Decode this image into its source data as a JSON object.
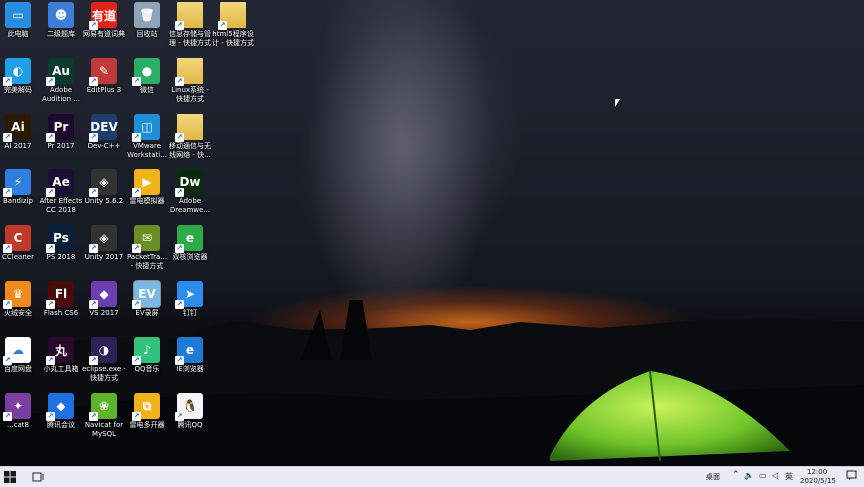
{
  "desktop": {
    "icons": [
      {
        "id": "pc",
        "label": "此电脑",
        "glyph": "▭",
        "bg": "#2a8ee0"
      },
      {
        "id": "erji",
        "label": "二级题库",
        "glyph": "☻",
        "bg": "#3b7fd8"
      },
      {
        "id": "youdao",
        "label": "网易有道词典",
        "glyph": "有道",
        "bg": "#e2231a"
      },
      {
        "id": "recycle",
        "label": "回收站",
        "glyph": "🗑",
        "bg": "#8fa3b8"
      },
      {
        "id": "info",
        "label": "信息存储与管\n理 - 快捷方式",
        "glyph": "",
        "bg": "#e8c15a"
      },
      {
        "id": "html5",
        "label": "html5程序设\n计 - 快捷方式",
        "glyph": "",
        "bg": "#e8c15a"
      },
      {
        "id": "wanmei",
        "label": "完美解码",
        "glyph": "◐",
        "bg": "#1e9fe6"
      },
      {
        "id": "audition",
        "label": "Adobe\nAudition ...",
        "glyph": "Au",
        "bg": "#0b3a2f"
      },
      {
        "id": "editplus",
        "label": "EditPlus 3",
        "glyph": "✎",
        "bg": "#c03a3a"
      },
      {
        "id": "wechat",
        "label": "微信",
        "glyph": "●",
        "bg": "#2aae67"
      },
      {
        "id": "linux",
        "label": "Linux系统 -\n快捷方式",
        "glyph": "",
        "bg": "#e8c15a"
      },
      {
        "id": "ai",
        "label": "AI 2017",
        "glyph": "Ai",
        "bg": "#2b1a00"
      },
      {
        "id": "pr",
        "label": "Pr 2017",
        "glyph": "Pr",
        "bg": "#1c0a2e"
      },
      {
        "id": "devcpp",
        "label": "Dev-C++",
        "glyph": "DEV",
        "bg": "#1d3d6b"
      },
      {
        "id": "vmware",
        "label": "VMware\nWorkstati...",
        "glyph": "◫",
        "bg": "#1c8fd6"
      },
      {
        "id": "mobile",
        "label": "移动通信与无\n线网络 - 快...",
        "glyph": "",
        "bg": "#e8c15a"
      },
      {
        "id": "bandizip",
        "label": "Bandizip",
        "glyph": "⚡",
        "bg": "#2f7fe0"
      },
      {
        "id": "ae",
        "label": "After Effects\nCC 2018",
        "glyph": "Ae",
        "bg": "#1b1033"
      },
      {
        "id": "unity562",
        "label": "Unity 5.6.2",
        "glyph": "◈",
        "bg": "#333"
      },
      {
        "id": "leidian",
        "label": "雷电模拟器",
        "glyph": "▶",
        "bg": "#f2b21a"
      },
      {
        "id": "dw",
        "label": "Adobe\nDreamwe...",
        "glyph": "Dw",
        "bg": "#082b0a"
      },
      {
        "id": "ccleaner",
        "label": "CCleaner",
        "glyph": "C",
        "bg": "#c0392b"
      },
      {
        "id": "ps",
        "label": "PS 2018",
        "glyph": "Ps",
        "bg": "#06203a"
      },
      {
        "id": "unity2017",
        "label": "Unity 2017",
        "glyph": "◈",
        "bg": "#333"
      },
      {
        "id": "packet",
        "label": "PacketTra...\n- 快捷方式",
        "glyph": "✉",
        "bg": "#6b8e23"
      },
      {
        "id": "shuanghe",
        "label": "双核浏览器",
        "glyph": "e",
        "bg": "#2eaa4a"
      },
      {
        "id": "huorong",
        "label": "火绒安全",
        "glyph": "♛",
        "bg": "#f08a1c"
      },
      {
        "id": "flash",
        "label": "Flash CS6",
        "glyph": "Fl",
        "bg": "#4a0a0a"
      },
      {
        "id": "vs",
        "label": "VS 2017",
        "glyph": "◆",
        "bg": "#6c3fb0"
      },
      {
        "id": "ev",
        "label": "EV录屏",
        "glyph": "EV",
        "bg": "#7ab8e6"
      },
      {
        "id": "dingding",
        "label": "钉钉",
        "glyph": "➤",
        "bg": "#2d8cf0"
      },
      {
        "id": "baidu",
        "label": "百度网盘",
        "glyph": "☁",
        "bg": "#fff"
      },
      {
        "id": "xiaowan",
        "label": "小丸工具箱",
        "glyph": "丸",
        "bg": "#2a0a2a"
      },
      {
        "id": "eclipse",
        "label": "eclipse.exe -\n快捷方式",
        "glyph": "◑",
        "bg": "#2c2255"
      },
      {
        "id": "qqmusic",
        "label": "QQ音乐",
        "glyph": "♪",
        "bg": "#31c27c"
      },
      {
        "id": "ie",
        "label": "IE浏览器",
        "glyph": "e",
        "bg": "#1f7ad6"
      },
      {
        "id": "navicat8",
        "label": "...cat8",
        "glyph": "✦",
        "bg": "#7b3fa0"
      },
      {
        "id": "tencentmeet",
        "label": "腾讯会议",
        "glyph": "⬥",
        "bg": "#1e6fe0"
      },
      {
        "id": "navicat",
        "label": "Navicat for\nMySQL",
        "glyph": "❀",
        "bg": "#5fb32a"
      },
      {
        "id": "leidianmulti",
        "label": "雷电多开器",
        "glyph": "⧉",
        "bg": "#f2b21a"
      },
      {
        "id": "qq",
        "label": "腾讯QQ",
        "glyph": "🐧",
        "bg": "#f5f5f5"
      }
    ]
  },
  "taskbar": {
    "desktop_label": "桌面",
    "ime_label": "英",
    "time": "12:00",
    "date": "2020/5/15",
    "accent": "#e8ebf1"
  }
}
